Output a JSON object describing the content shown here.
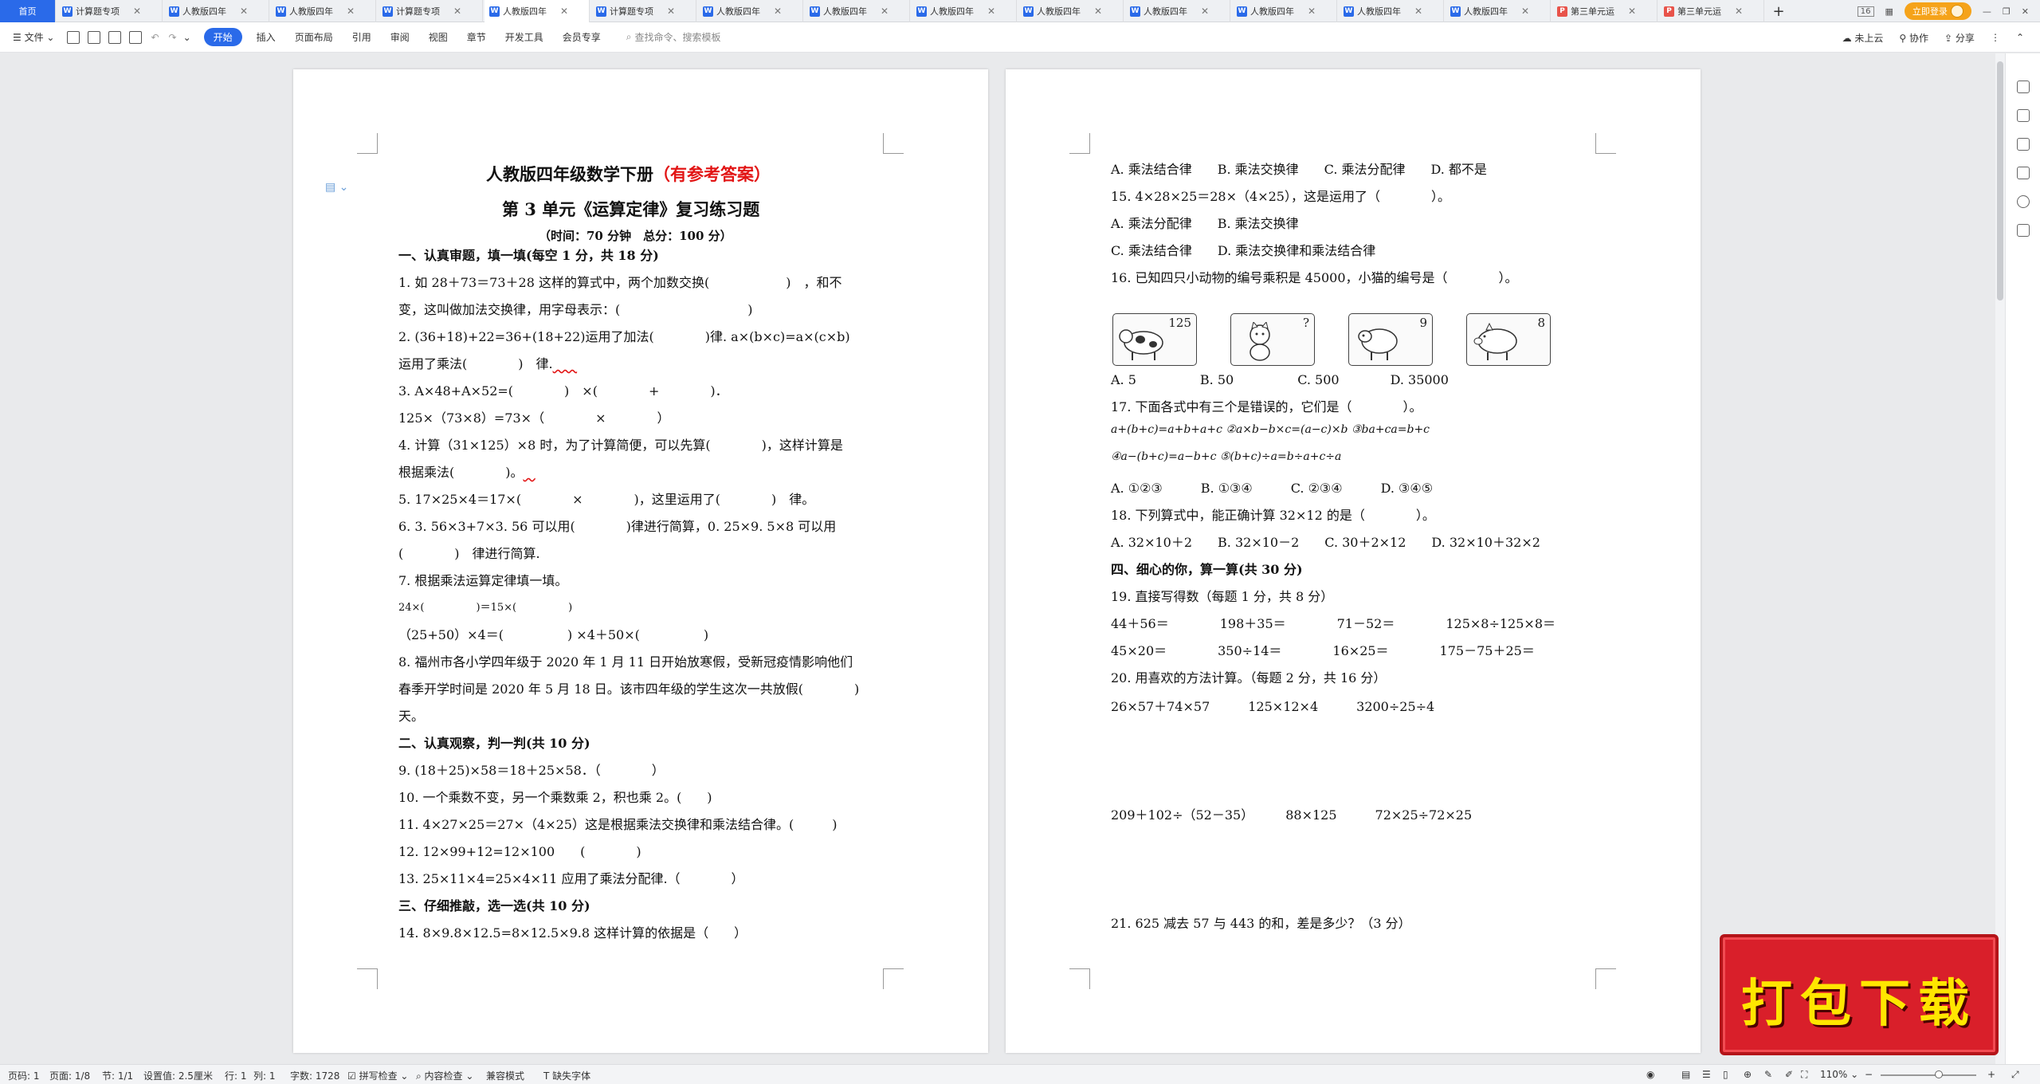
{
  "tabs": [
    {
      "label": "首页"
    },
    {
      "label": "计算题专项"
    },
    {
      "label": "人教版四年"
    },
    {
      "label": "人教版四年"
    },
    {
      "label": "计算题专项"
    },
    {
      "label": "人教版四年"
    },
    {
      "label": "计算题专项"
    },
    {
      "label": "人教版四年"
    },
    {
      "label": "人教版四年"
    },
    {
      "label": "人教版四年"
    },
    {
      "label": "人教版四年"
    },
    {
      "label": "人教版四年"
    },
    {
      "label": "人教版四年"
    },
    {
      "label": "人教版四年"
    },
    {
      "label": "人教版四年"
    },
    {
      "label": "第三单元运"
    },
    {
      "label": "第三单元运"
    }
  ],
  "tabbar_right": {
    "counter": "16",
    "login": "立即登录"
  },
  "toolbar": {
    "file": "文件",
    "menus": [
      "开始",
      "插入",
      "页面布局",
      "引用",
      "审阅",
      "视图",
      "章节",
      "开发工具",
      "会员专享"
    ],
    "search_placeholder": "查找命令、搜索模板",
    "right": [
      "未上云",
      "协作",
      "分享"
    ]
  },
  "page1": {
    "title_black": "人教版四年级数学下册",
    "title_red": "（有参考答案）",
    "subtitle": "第 3 单元《运算定律》复习练习题",
    "time_line": "（时间：70 分钟　总分：100 分）",
    "lines": [
      "一、认真审题，填一填(每空 1 分，共 18 分)",
      "1. 如 28＋73＝73＋28 这样的算式中，两个加数交换(　　　　　　)　，和不",
      "变，这叫做加法交换律，用字母表示：(　　　　　　　　　　)",
      "2. (36+18)+22=36+(18+22)运用了加法(　　　　)律. a×(b×c)=a×(c×b)",
      "运用了乘法(　　　　)　律.",
      "3. A×48+A×52=(　　　　)　×(　　　　+　　　　)．",
      "125×（73×8）=73×（　　　　×　　　　）",
      "4. 计算（31×125）×8 时，为了计算简便，可以先算(　　　　)，这样计算是",
      "根据乘法(　　　　)。",
      "5. 17×25×4＝17×(　　　　×　　　　)，这里运用了(　　　　)　律。",
      "6. 3. 56×3+7×3. 56 可以用(　　　　)律进行简算，0. 25×9. 5×8 可以用",
      "(　　　　)　律进行简算.",
      "7. 根据乘法运算定律填一填。",
      "24×(　　　　　)＝15×(　　　　　)",
      "（25+50）×4＝(　　　　　) ×4＋50×(　　　　　)",
      "8. 福州市各小学四年级于 2020 年 1 月 11 日开始放寒假，受新冠疫情影响他们",
      "春季开学时间是 2020 年 5 月 18 日。该市四年级的学生这次一共放假(　　　　)",
      "天。",
      "二、认真观察，判一判(共 10 分)",
      "9. (18＋25)×58＝18＋25×58．（　　　　）",
      "10. 一个乘数不变，另一个乘数乘 2，积也乘 2。(　　)",
      "11. 4×27×25＝27×（4×25）这是根据乘法交换律和乘法结合律。(　　　)",
      "12. 12×99+12=12×100　　(　　　　)",
      "13. 25×11×4=25×4×11 应用了乘法分配律.（　　　　）",
      "三、仔细推敲，选一选(共 10 分)",
      "14. 8×9.8×12.5=8×12.5×9.8 这样计算的依据是（　　）"
    ]
  },
  "page2": {
    "lines": [
      "A. 乘法结合律　　B. 乘法交换律　　C. 乘法分配律　　D. 都不是",
      "15. 4×28×25＝28×（4×25），这是运用了（　　　　）。",
      "A. 乘法分配律　　B. 乘法交换律",
      "C. 乘法结合律　　D. 乘法交换律和乘法结合律",
      "16. 已知四只小动物的编号乘积是 45000，小猫的编号是（　　　　）。"
    ],
    "animals": [
      {
        "name": "cow",
        "label": "125"
      },
      {
        "name": "cat",
        "label": "?"
      },
      {
        "name": "sheep",
        "label": "9"
      },
      {
        "name": "pig",
        "label": "8"
      }
    ],
    "lines2": [
      "A. 5　　　　　B. 50　　　　　C. 500　　　　D. 35000",
      "17. 下面各式中有三个是错误的，它们是（　　　　）。",
      "a+(b+c)=a+b+a+c ②a×b−b×c=(a−c)×b ③ba+ca=b+c",
      "④a−(b+c)=a−b+c ⑤(b+c)÷a=b÷a+c÷a",
      "A. ①②③　　　B. ①③④　　　C. ②③④　　　D. ③④⑤",
      "18. 下列算式中，能正确计算 32×12 的是（　　　　）。",
      "A. 32×10＋2　　B. 32×10－2　　C. 30＋2×12　　D. 32×10＋32×2",
      "四、细心的你，算一算(共 30 分)",
      "19. 直接写得数（每题 1 分，共 8 分）",
      "44＋56＝　　　　198＋35＝　　　　71－52＝　　　　125×8÷125×8＝",
      "45×20＝　　　　350÷14＝　　　　16×25＝　　　　175－75＋25＝",
      "20. 用喜欢的方法计算。（每题 2 分，共 16 分）",
      "26×57＋74×57　　　125×12×4　　　3200÷25÷4",
      "209＋102÷（52－35）　　　88×125　　　72×25÷72×25",
      "21. 625 减去 57 与 443 的和，差是多少？（3 分）"
    ]
  },
  "statusbar": {
    "items": [
      "页码: 1",
      "页面: 1/8",
      "节: 1/1",
      "设置值: 2.5厘米",
      "行: 1",
      "列: 1",
      "字数: 1728",
      "拼写检查",
      "内容检查",
      "兼容模式",
      "缺失字体"
    ],
    "zoom": "110%"
  },
  "download_badge": "打包下载"
}
